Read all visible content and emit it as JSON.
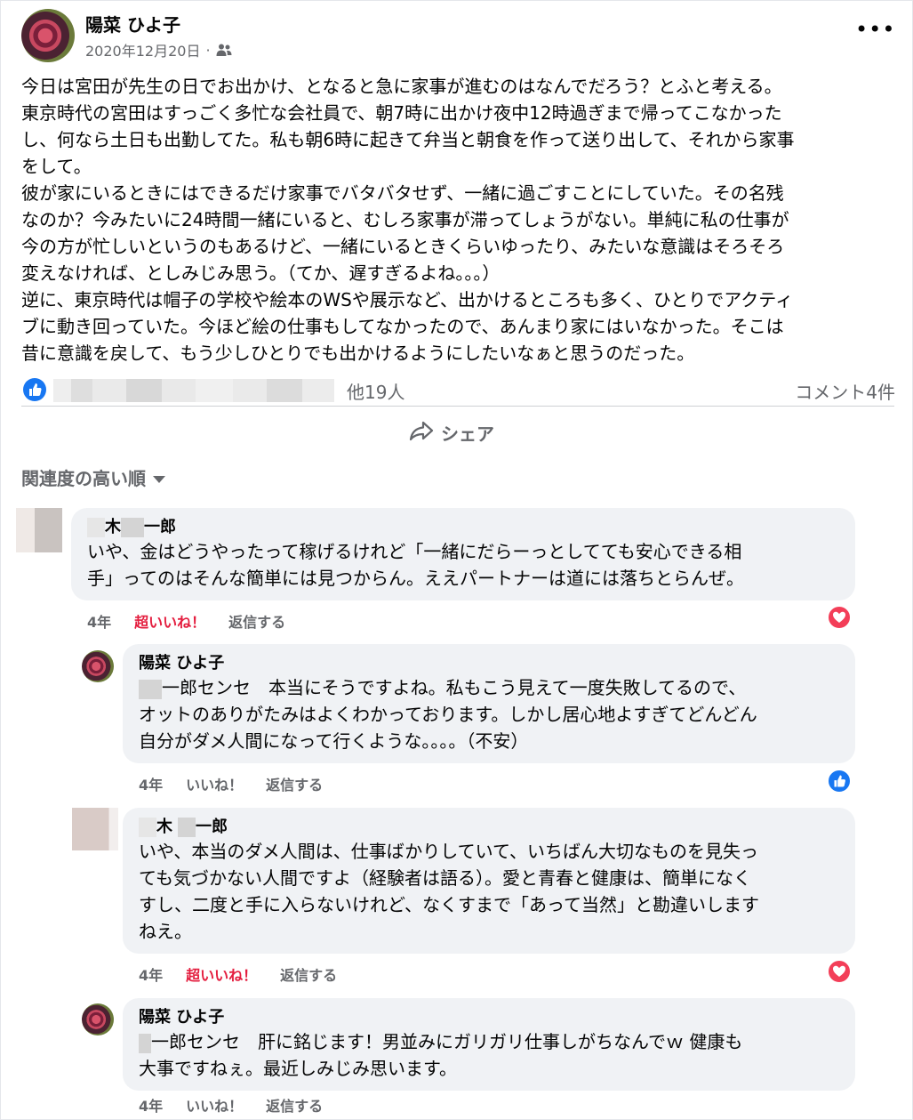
{
  "post": {
    "author": "陽菜 ひよ子",
    "date": "2020年12月20日",
    "separator": "·",
    "audience_icon": "friends-icon",
    "more_label": "•••",
    "body_lines": [
      "今日は宮田が先生の日でお出かけ、となると急に家事が進むのはなんでだろう？とふと考える。",
      "東京時代の宮田はすっごく多忙な会社員で、朝7時に出かけ夜中12時過ぎまで帰ってこなかった",
      "し、何なら土日も出勤してた。私も朝6時に起きて弁当と朝食を作って送り出して、それから家事",
      "をして。",
      "彼が家にいるときにはできるだけ家事でバタバタせず、一緒に過ごすことにしていた。その名残",
      "なのか？今みたいに24時間一緒にいると、むしろ家事が滞ってしょうがない。単純に私の仕事が",
      "今の方が忙しいというのもあるけど、一緒にいるときくらいゆったり、みたいな意識はそろそろ",
      "変えなければ、としみじみ思う。（てか、遅すぎるよね。。。）",
      "逆に、東京時代は帽子の学校や絵本のWSや展示など、出かけるところも多く、ひとりでアクティ",
      "ブに動き回っていた。今ほど絵の仕事もしてなかったので、あんまり家にはいなかった。そこは",
      "昔に意識を戻して、もう少しひとりでも出かけるようにしたいなぁと思うのだった。"
    ],
    "reactions_others": "他19人",
    "comment_count": "コメント4件",
    "share_label": "シェア"
  },
  "sort_label": "関連度の高い順",
  "comments": [
    {
      "name_parts": [
        "木",
        "一郎"
      ],
      "lines": [
        "いや、金はどうやったって稼げるけれど「一緒にだらーっとしてても安心できる相",
        "手」ってのはそんな簡単には見つからん。ええパートナーは道には落ちとらんぜ。"
      ],
      "time": "4年",
      "react_label": "超いいね！",
      "reply_label": "返信する",
      "reaction_icon": "love-icon"
    },
    {
      "name": "陽菜 ひよ子",
      "first_line_rest": "一郎センセ　本当にそうですよね。私もこう見えて一度失敗してるので、",
      "lines": [
        "オットのありがたみはよくわかっております。しかし居心地よすぎてどんどん",
        "自分がダメ人間になって行くような。。。。（不安）"
      ],
      "time": "4年",
      "react_label": "いいね！",
      "reply_label": "返信する",
      "reaction_icon": "like-icon"
    },
    {
      "name_parts": [
        "木",
        "一郎"
      ],
      "lines": [
        "いや、本当のダメ人間は、仕事ばかりしていて、いちばん大切なものを見失っ",
        "ても気づかない人間ですよ（経験者は語る）。愛と青春と健康は、簡単になく",
        "すし、二度と手に入らないけれど、なくすまで「あって当然」と勘違いします",
        "ねえ。"
      ],
      "time": "4年",
      "react_label": "超いいね！",
      "reply_label": "返信する",
      "reaction_icon": "love-icon"
    },
    {
      "name": "陽菜 ひよ子",
      "first_line_rest": "一郎センセ　肝に銘じます！男並みにガリガリ仕事しがちなんでｗ 健康も",
      "lines": [
        "大事ですねぇ。最近しみじみ思います。"
      ],
      "time": "4年",
      "react_label": "いいね！",
      "reply_label": "返信する"
    }
  ]
}
